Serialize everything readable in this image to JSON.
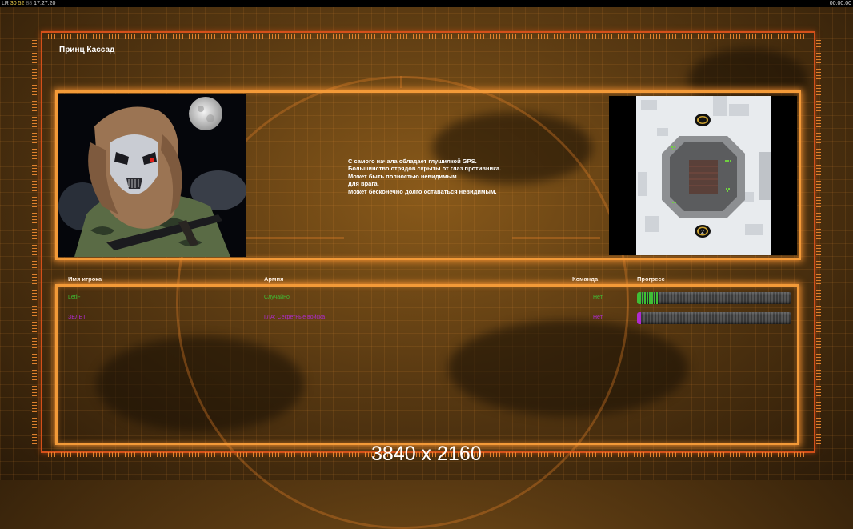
{
  "topbar": {
    "left_prefix": "LR",
    "left_num1": "30",
    "left_num2": "52",
    "left_num3": "88",
    "time": "17:27:20",
    "right_time": "00:00:00"
  },
  "general_name": "Принц Кассад",
  "description": [
    "С самого начала обладает глушилкой GPS.",
    "Большинство отрядов скрыты от глаз противника.",
    "Может быть полностью невидимым",
    "для врага.",
    "Может бесконечно долго оставаться невидимым."
  ],
  "columns": {
    "player": "Имя игрока",
    "army": "Армия",
    "team": "Команда",
    "progress": "Прогресс"
  },
  "players": [
    {
      "name": "LetiF",
      "army": "Случайно",
      "team": "Нет",
      "progress": 0.14,
      "color": "#3fbf34"
    },
    {
      "name": "ЗЕЛЕТ",
      "army": "ГЛА: Секретные войска",
      "team": "Нет",
      "progress": 0.03,
      "color": "#b02ad0"
    }
  ],
  "minimap": {
    "start_marker": "2"
  },
  "resolution_watermark": "3840 x 2160"
}
